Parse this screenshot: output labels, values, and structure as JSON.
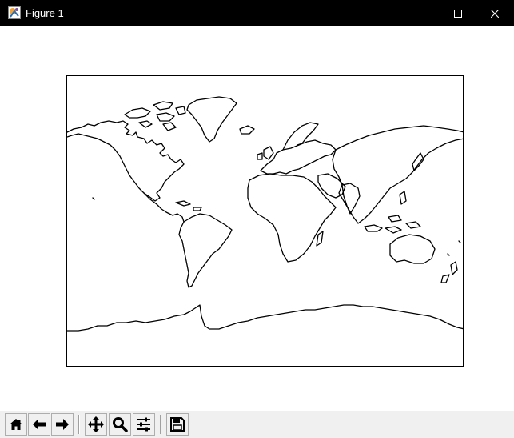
{
  "window": {
    "title": "Figure 1",
    "app_icon": "matplotlib-figure-icon",
    "controls": [
      "minimize-icon",
      "maximize-icon",
      "close-icon"
    ]
  },
  "figure": {
    "content": "world-coastline-map",
    "projection": "mercator",
    "line_color": "#000000",
    "background": "#ffffff"
  },
  "toolbar": {
    "buttons": [
      {
        "icon": "home-icon"
      },
      {
        "icon": "back-arrow-icon"
      },
      {
        "icon": "forward-arrow-icon"
      },
      {
        "icon": "pan-move-icon"
      },
      {
        "icon": "zoom-magnifier-icon"
      },
      {
        "icon": "configure-subplots-icon"
      },
      {
        "icon": "save-disk-icon"
      }
    ]
  }
}
